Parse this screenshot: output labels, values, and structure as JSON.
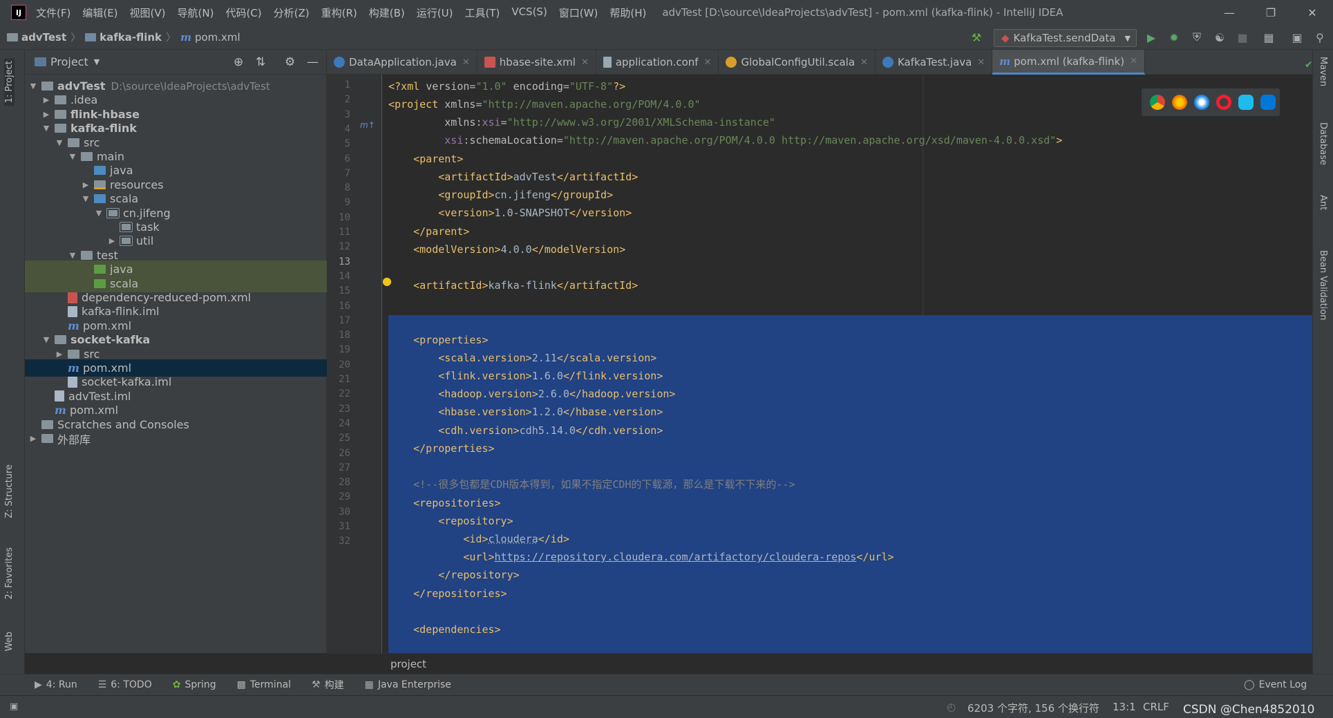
{
  "titlebar": {
    "logo_text": "IJ",
    "menu": [
      "文件(F)",
      "编辑(E)",
      "视图(V)",
      "导航(N)",
      "代码(C)",
      "分析(Z)",
      "重构(R)",
      "构建(B)",
      "运行(U)",
      "工具(T)",
      "VCS(S)",
      "窗口(W)",
      "帮助(H)"
    ],
    "window_title": "advTest [D:\\source\\IdeaProjects\\advTest] - pom.xml (kafka-flink) - IntelliJ IDEA"
  },
  "navbar": {
    "crumbs": [
      "advTest",
      "kafka-flink",
      "pom.xml"
    ],
    "run_config": "KafkaTest.sendData"
  },
  "left_tools": [
    "1: Project",
    "Z: Structure",
    "2: Favorites",
    "Web"
  ],
  "right_tools": [
    "Maven",
    "Database",
    "Ant",
    "Bean Validation"
  ],
  "project_panel": {
    "title": "Project",
    "tree": [
      {
        "label": "advTest",
        "extra": "D:\\source\\IdeaProjects\\advTest"
      },
      {
        "label": ".idea"
      },
      {
        "label": "flink-hbase"
      },
      {
        "label": "kafka-flink"
      },
      {
        "label": "src"
      },
      {
        "label": "main"
      },
      {
        "label": "java"
      },
      {
        "label": "resources"
      },
      {
        "label": "scala"
      },
      {
        "label": "cn.jifeng"
      },
      {
        "label": "task"
      },
      {
        "label": "util"
      },
      {
        "label": "test"
      },
      {
        "label": "java"
      },
      {
        "label": "scala"
      },
      {
        "label": "dependency-reduced-pom.xml"
      },
      {
        "label": "kafka-flink.iml"
      },
      {
        "label": "pom.xml"
      },
      {
        "label": "socket-kafka"
      },
      {
        "label": "src"
      },
      {
        "label": "pom.xml"
      },
      {
        "label": "socket-kafka.iml"
      },
      {
        "label": "advTest.iml"
      },
      {
        "label": "pom.xml"
      },
      {
        "label": "Scratches and Consoles"
      },
      {
        "label": "外部库"
      }
    ]
  },
  "editor": {
    "tabs": [
      "DataApplication.java",
      "hbase-site.xml",
      "application.conf",
      "GlobalConfigUtil.scala",
      "KafkaTest.java",
      "pom.xml (kafka-flink)"
    ],
    "line_numbers": [
      "1",
      "2",
      "3",
      "4",
      "5",
      "6",
      "7",
      "8",
      "9",
      "10",
      "11",
      "12",
      "13",
      "14",
      "15",
      "16",
      "17",
      "18",
      "19",
      "20",
      "21",
      "22",
      "23",
      "24",
      "25",
      "26",
      "27",
      "28",
      "29",
      "30",
      "31",
      "32"
    ],
    "breadcrumb": "project"
  },
  "bottom_tools": [
    "4: Run",
    "6: TODO",
    "Spring",
    "Terminal",
    "构建",
    "Java Enterprise",
    "Event Log"
  ],
  "status": {
    "chars": "6203 个字符, 156 个换行符",
    "position": "13:1",
    "line_sep": "CRLF",
    "watermark": "CSDN @Chen4852010"
  }
}
